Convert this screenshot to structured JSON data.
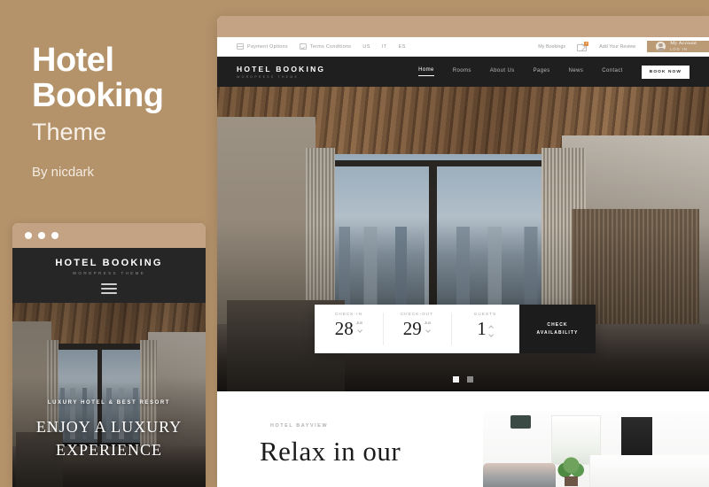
{
  "promo": {
    "title_line1": "Hotel",
    "title_line2": "Booking",
    "subtitle": "Theme",
    "author": "By nicdark"
  },
  "colors": {
    "background": "#b4926a",
    "chrome": "#c4a384",
    "account_bar": "#bb9a76",
    "nav_dark": "#1f1f1f",
    "badge": "#e08a3c"
  },
  "mobile_mockup": {
    "logo": "HOTEL BOOKING",
    "logo_sub": "WORDPRESS THEME",
    "menu_icon": "hamburger-icon",
    "hero_kicker": "LUXURY HOTEL & BEST RESORT",
    "hero_heading_line1": "ENJOY A LUXURY",
    "hero_heading_line2": "EXPERIENCE"
  },
  "desktop_mockup": {
    "topbar": {
      "left_items": [
        {
          "label": "Payment Options",
          "icon": "credit-card-icon"
        },
        {
          "label": "Terms Conditions",
          "icon": "document-check-icon"
        }
      ],
      "languages": [
        "US",
        "IT",
        "ES"
      ],
      "bookings_label": "My Bookings",
      "cart_icon": "cart-icon",
      "cart_count": "4",
      "review_label": "Add Your Review",
      "account_name": "My Account",
      "account_action": "LOG IN",
      "avatar_icon": "avatar-icon"
    },
    "nav": {
      "logo": "HOTEL BOOKING",
      "logo_sub": "WORDPRESS THEME",
      "items": [
        {
          "label": "Home",
          "active": true
        },
        {
          "label": "Rooms",
          "active": false
        },
        {
          "label": "About Us",
          "active": false
        },
        {
          "label": "Pages",
          "active": false
        },
        {
          "label": "News",
          "active": false
        },
        {
          "label": "Contact",
          "active": false
        }
      ],
      "cta_label": "BOOK NOW"
    },
    "booking_widget": {
      "checkin_label": "CHECK-IN",
      "checkin_day": "28",
      "checkin_month": "Jun",
      "checkout_label": "CHECK-OUT",
      "checkout_day": "29",
      "checkout_month": "Jun",
      "guests_label": "GUESTS",
      "guests_value": "1",
      "submit_line1": "CHECK",
      "submit_line2": "AVAILABILITY",
      "chevron_icon": "chevron-down-icon",
      "stepper_up_icon": "chevron-up-icon",
      "stepper_down_icon": "chevron-down-icon"
    },
    "slider": {
      "dots": 2,
      "active_index": 0
    },
    "section": {
      "kicker": "HOTEL BAYVIEW",
      "heading": "Relax in our"
    }
  }
}
